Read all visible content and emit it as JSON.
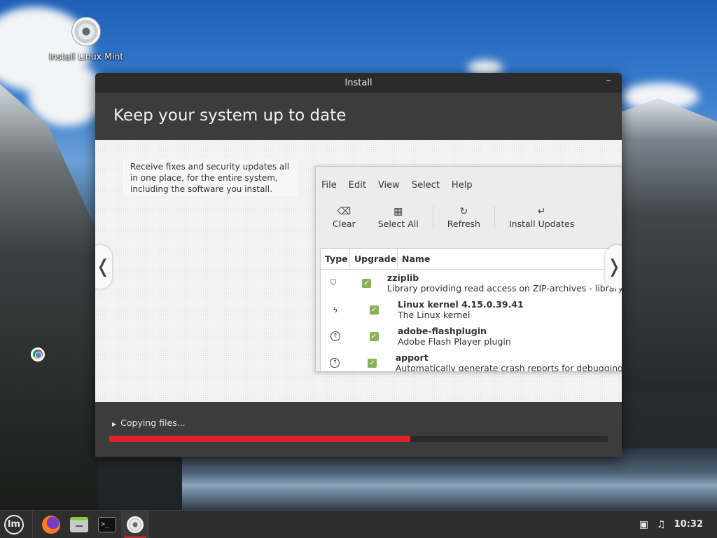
{
  "desktop": {
    "icons": [
      {
        "label": "Install Linux Mint",
        "icon": "disc-icon"
      }
    ]
  },
  "window": {
    "title": "Install",
    "minimize_glyph": "–",
    "header": "Keep your system up to date",
    "slide": {
      "description": "Receive fixes and security updates all in one place, for the entire system, including the software you install.",
      "prev_glyph": "❬",
      "next_glyph": "❭"
    },
    "mock_app": {
      "menu": [
        "File",
        "Edit",
        "View",
        "Select",
        "Help"
      ],
      "toolbar": [
        {
          "label": "Clear",
          "icon": "clear-icon",
          "glyph": "⌫"
        },
        {
          "label": "Select All",
          "icon": "select-all-icon",
          "glyph": "▦"
        },
        {
          "label": "Refresh",
          "icon": "refresh-icon",
          "glyph": "↻"
        },
        {
          "label": "Install Updates",
          "icon": "install-icon",
          "glyph": "↵"
        }
      ],
      "columns": [
        "Type",
        "Upgrade",
        "Name"
      ],
      "rows": [
        {
          "type_icon": "shield-icon",
          "type_glyph": "⛉",
          "checked": true,
          "name": "zziplib",
          "desc": "Library providing read access on ZIP-archives - library"
        },
        {
          "type_icon": "kernel-icon",
          "type_glyph": "ϟ",
          "checked": true,
          "name": "Linux kernel 4.15.0.39.41",
          "desc": "The Linux kernel"
        },
        {
          "type_icon": "upgrade-icon",
          "type_glyph": "↑",
          "checked": true,
          "name": "adobe-flashplugin",
          "desc": "Adobe Flash Player plugin"
        },
        {
          "type_icon": "upgrade-icon",
          "type_glyph": "↑",
          "checked": true,
          "name": "apport",
          "desc": "Automatically generate crash reports for debugging"
        }
      ],
      "check_glyph": "✓"
    },
    "progress": {
      "label": "Copying files...",
      "fraction": 0.604,
      "color": "#e0232b"
    }
  },
  "taskbar": {
    "menu_logo": "lm",
    "terminal_glyph": ">_",
    "tray": {
      "network_glyph": "▣",
      "sound_glyph": "♫",
      "clock": "10:32"
    }
  }
}
